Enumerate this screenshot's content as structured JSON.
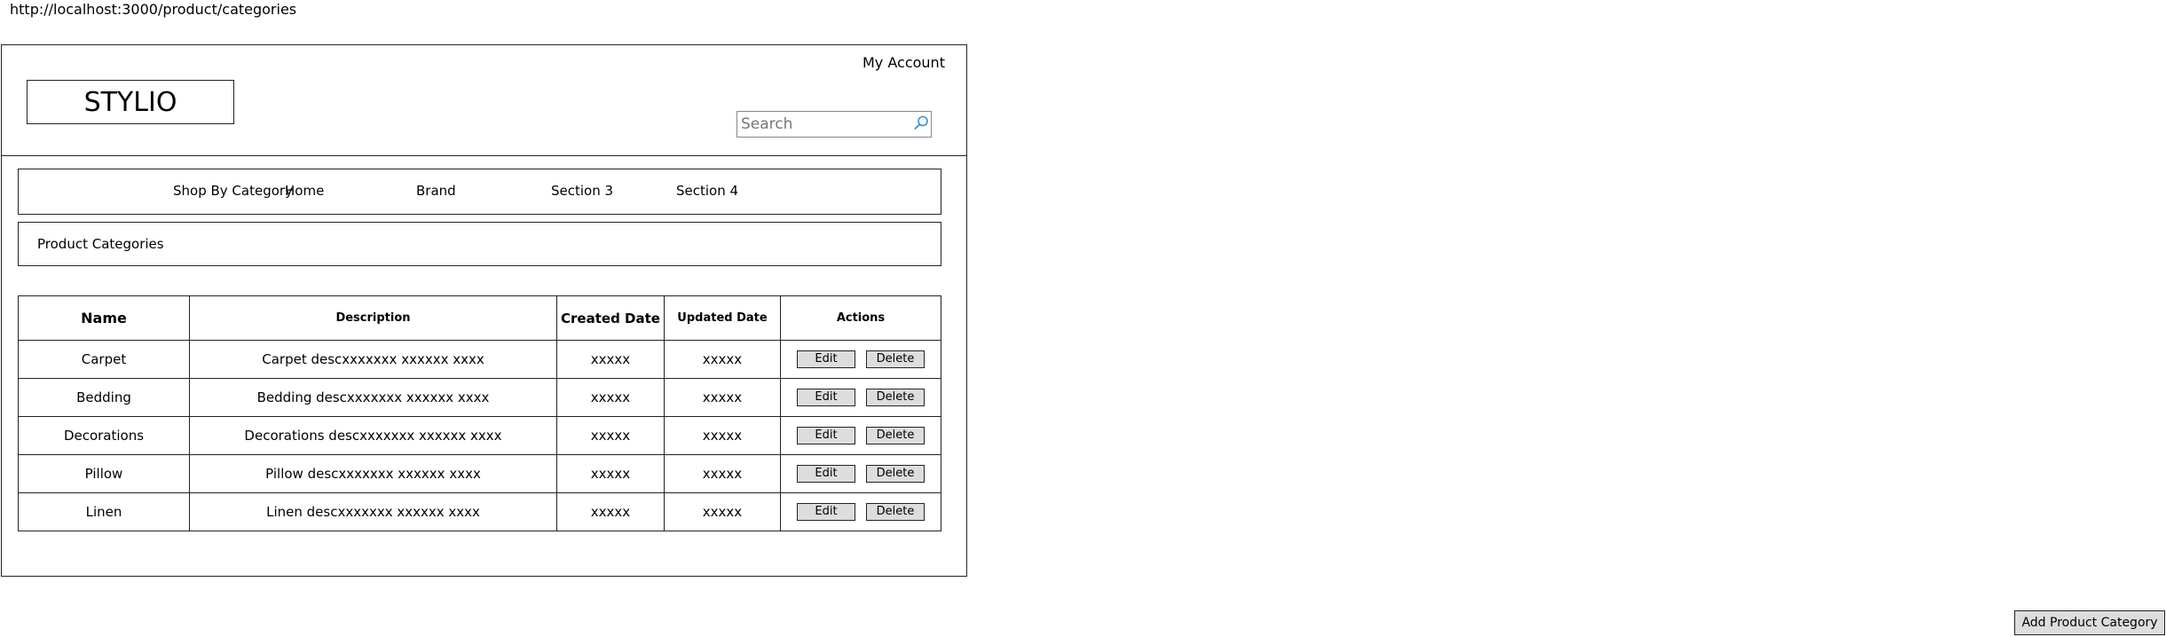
{
  "url": "http://localhost:3000/product/categories",
  "header": {
    "account_label": "My Account",
    "logo_text": "STYLIO",
    "search": {
      "placeholder": "Search",
      "value": ""
    }
  },
  "nav": {
    "items": [
      {
        "label": "Shop By Category"
      },
      {
        "label": "Home"
      },
      {
        "label": "Brand"
      },
      {
        "label": "Section 3"
      },
      {
        "label": "Section 4"
      }
    ]
  },
  "breadcrumb": {
    "label": "Product Categories"
  },
  "table": {
    "headers": {
      "name": "Name",
      "description": "Description",
      "created": "Created Date",
      "updated": "Updated Date",
      "actions": "Actions"
    },
    "rows": [
      {
        "name": "Carpet",
        "description": "Carpet descxxxxxxx xxxxxx xxxx",
        "created": "xxxxx",
        "updated": "xxxxx"
      },
      {
        "name": "Bedding",
        "description": "Bedding descxxxxxxx xxxxxx xxxx",
        "created": "xxxxx",
        "updated": "xxxxx"
      },
      {
        "name": "Decorations",
        "description": "Decorations descxxxxxxx xxxxxx xxxx",
        "created": "xxxxx",
        "updated": "xxxxx"
      },
      {
        "name": "Pillow",
        "description": "Pillow descxxxxxxx xxxxxx xxxx",
        "created": "xxxxx",
        "updated": "xxxxx"
      },
      {
        "name": "Linen",
        "description": "Linen descxxxxxxx xxxxxx xxxx",
        "created": "xxxxx",
        "updated": "xxxxx"
      }
    ],
    "edit_label": "Edit",
    "delete_label": "Delete"
  },
  "add_button_label": "Add Product Category",
  "icons": {
    "search": "search-icon"
  },
  "colors": {
    "button_bg": "#dddddd",
    "search_icon": "#3a8fd0",
    "line": "#222222"
  }
}
